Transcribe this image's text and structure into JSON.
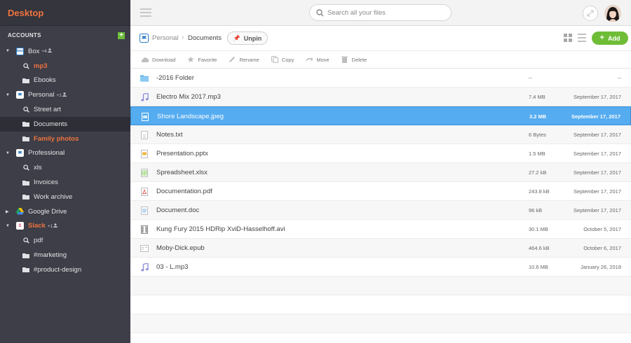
{
  "sidebar": {
    "title": "Desktop",
    "accounts_label": "ACCOUNTS",
    "add_account": "+",
    "tree": [
      {
        "label": "Box",
        "badge": "+4",
        "service": "box",
        "icon_text": "box",
        "expanded": true,
        "children": [
          {
            "label": "mp3",
            "icon": "search-icon",
            "accent": true
          },
          {
            "label": "Ebooks",
            "icon": "folder-icon"
          }
        ]
      },
      {
        "label": "Personal",
        "badge": "+1",
        "service": "dropbox",
        "expanded": true,
        "children": [
          {
            "label": "Street art",
            "icon": "search-icon"
          },
          {
            "label": "Documents",
            "icon": "folder-icon",
            "selected": true
          },
          {
            "label": "Family photos",
            "icon": "folder-icon",
            "accent": true
          }
        ]
      },
      {
        "label": "Professional",
        "badge": "",
        "service": "dropbox",
        "expanded": true,
        "children": [
          {
            "label": "xls",
            "icon": "search-icon"
          },
          {
            "label": "Invoices",
            "icon": "folder-icon"
          },
          {
            "label": "Work archive",
            "icon": "folder-icon"
          }
        ]
      },
      {
        "label": "Google Drive",
        "badge": "",
        "service": "gdrive",
        "expanded": false,
        "children": []
      },
      {
        "label": "Slack",
        "badge": "+1",
        "service": "slack",
        "expanded": true,
        "accent": true,
        "children": [
          {
            "label": "pdf",
            "icon": "search-icon"
          },
          {
            "label": "#marketing",
            "icon": "folder-icon"
          },
          {
            "label": "#product-design",
            "icon": "folder-icon"
          }
        ]
      }
    ]
  },
  "topbar": {
    "search_placeholder": "Search all your files"
  },
  "breadcrumb": {
    "root": "Personal",
    "current": "Documents",
    "unpin_label": "Unpin",
    "add_label": "Add"
  },
  "toolbar": {
    "actions": [
      {
        "label": "Download",
        "icon": "cloud-download-icon"
      },
      {
        "label": "Favorite",
        "icon": "star-icon"
      },
      {
        "label": "Rename",
        "icon": "pencil-icon"
      },
      {
        "label": "Copy",
        "icon": "copy-icon"
      },
      {
        "label": "Move",
        "icon": "move-icon"
      },
      {
        "label": "Delete",
        "icon": "trash-icon"
      }
    ]
  },
  "files": [
    {
      "name": "-2016 Folder",
      "type": "folder",
      "size": "--",
      "date": "--"
    },
    {
      "name": "Electro Mix 2017.mp3",
      "type": "audio",
      "size": "7.4 MB",
      "date": "September 17, 2017"
    },
    {
      "name": "Shore Landscape.jpeg",
      "type": "image",
      "size": "3.2 MB",
      "date": "September 17, 2017",
      "selected": true
    },
    {
      "name": "Notes.txt",
      "type": "text",
      "size": "6 Bytes",
      "date": "September 17, 2017"
    },
    {
      "name": "Presentation.pptx",
      "type": "presentation",
      "size": "1.5 MB",
      "date": "September 17, 2017"
    },
    {
      "name": "Spreadsheet.xlsx",
      "type": "spreadsheet",
      "size": "27.2 kB",
      "date": "September 17, 2017"
    },
    {
      "name": "Documentation.pdf",
      "type": "pdf",
      "size": "243.8 kB",
      "date": "September 17, 2017"
    },
    {
      "name": "Document.doc",
      "type": "doc",
      "size": "96 kB",
      "date": "September 17, 2017"
    },
    {
      "name": "Kung Fury 2015 HDRip XviD-Hasselhoff.avi",
      "type": "video",
      "size": "30.1 MB",
      "date": "October 5, 2017"
    },
    {
      "name": "Moby-Dick.epub",
      "type": "ebook",
      "size": "464.6 kB",
      "date": "October 6, 2017"
    },
    {
      "name": "03 - L.mp3",
      "type": "audio",
      "size": "10.6 MB",
      "date": "January 26, 2018"
    }
  ],
  "colors": {
    "accent": "#f0733f",
    "selection": "#55acf0",
    "add_green": "#6fbd37",
    "sidebar_bg": "#3d3e47"
  }
}
